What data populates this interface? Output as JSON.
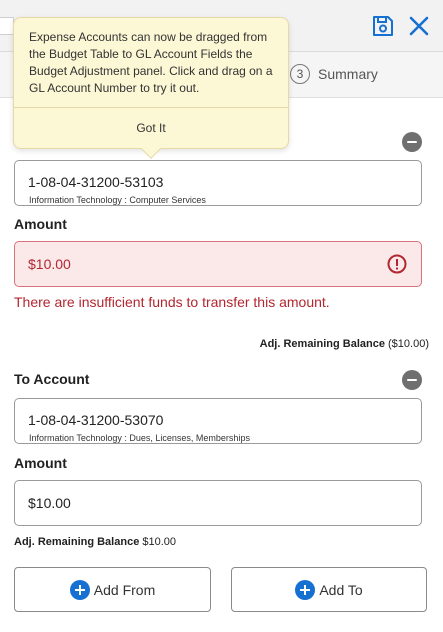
{
  "header": {
    "save_icon": "floppy-disk-icon",
    "close_icon": "close-x-icon",
    "accent_color": "#1570d1"
  },
  "stepper": {
    "steps": [
      {
        "number": "3",
        "label": "Summary"
      }
    ]
  },
  "tooltip": {
    "message": "Expense Accounts can now be dragged from the Budget Table to GL Account Fields the Budget Adjustment panel. Click and drag on a GL Account Number to try it out.",
    "button_label": "Got It"
  },
  "from_account": {
    "account_number": "1-08-04-31200-53103",
    "description": "Information Technology : Computer Services",
    "amount_label": "Amount",
    "amount_value": "$10.00",
    "error_message": "There are insufficient funds to transfer this amount.",
    "balance_label": "Adj. Remaining Balance",
    "balance_value": "($10.00)",
    "error_color": "#b3262f"
  },
  "to_account": {
    "section_label": "To Account",
    "account_number": "1-08-04-31200-53070",
    "description": "Information Technology : Dues, Licenses, Memberships",
    "amount_label": "Amount",
    "amount_value": "$10.00",
    "balance_label": "Adj. Remaining Balance",
    "balance_value": "$10.00"
  },
  "actions": {
    "add_from_label": "Add From",
    "add_to_label": "Add To"
  }
}
